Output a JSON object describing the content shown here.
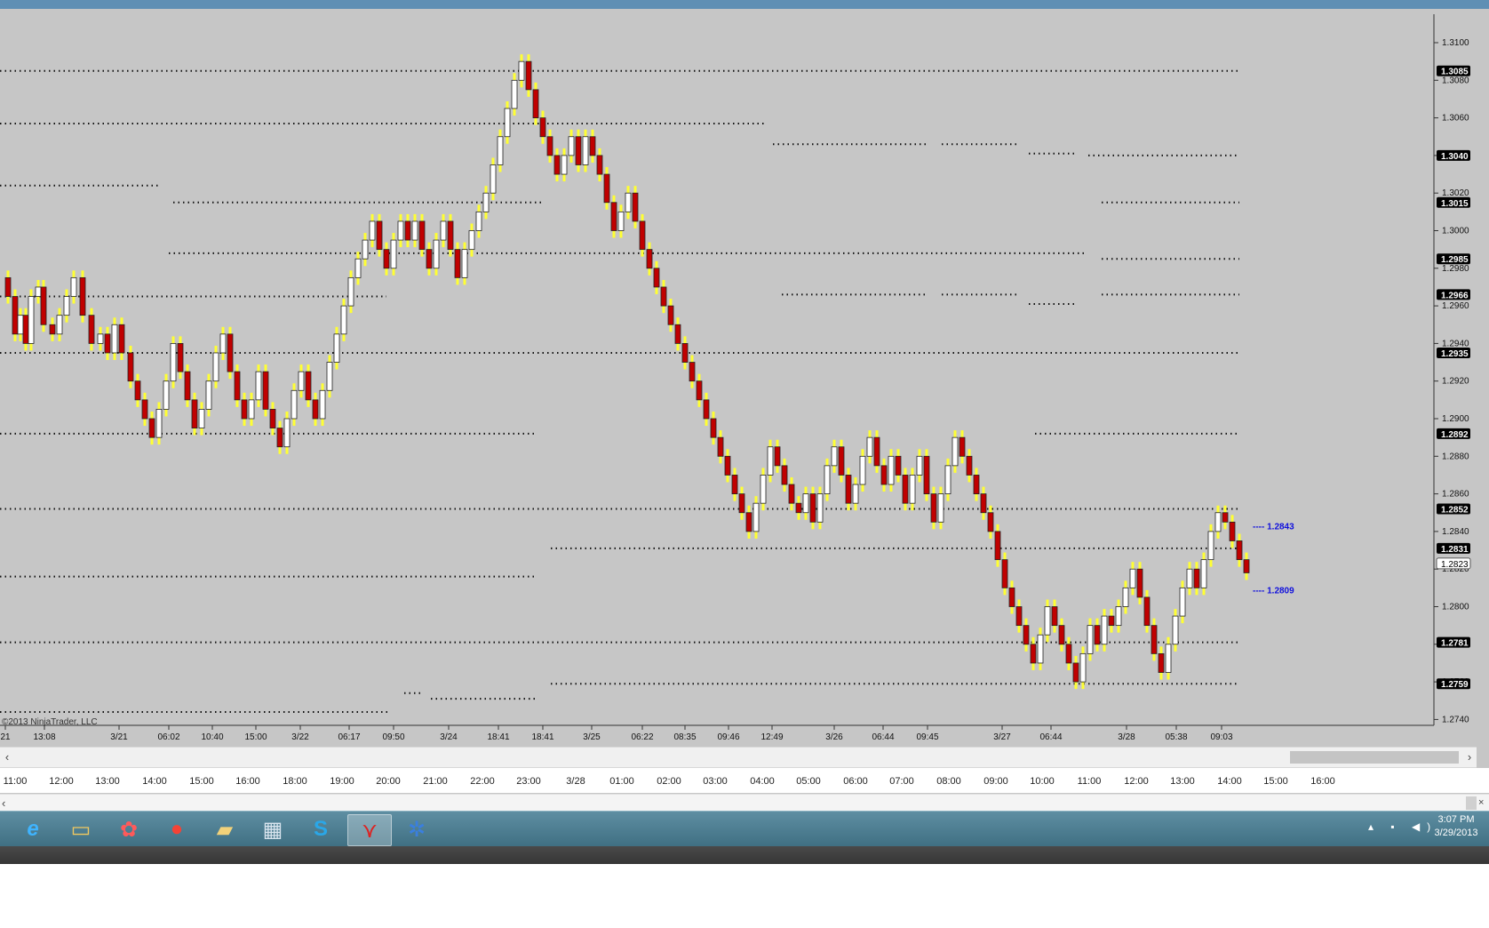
{
  "copyright": "©2013 NinjaTrader, LLC",
  "colors": {
    "background": "#c6c6c6",
    "bull_bar": "#ffffff",
    "bear_bar": "#c00000",
    "wick": "#ffff33",
    "level_line": "#111111",
    "price_marker": "#1010dd"
  },
  "price_axis": {
    "ticks": [
      "1.3100",
      "1.3080",
      "1.3060",
      "1.3040",
      "1.3020",
      "1.3000",
      "1.2980",
      "1.2960",
      "1.2940",
      "1.2920",
      "1.2900",
      "1.2880",
      "1.2860",
      "1.2840",
      "1.2820",
      "1.2800",
      "1.2780",
      "1.2760",
      "1.2740"
    ],
    "badges": [
      "1.3085",
      "1.3040",
      "1.3015",
      "1.2985",
      "1.2966",
      "1.2935",
      "1.2892",
      "1.2852",
      "1.2831",
      "1.2781",
      "1.2759"
    ],
    "current_price": "1.2823"
  },
  "markers": {
    "upper": "---- 1.2843",
    "lower": "---- 1.2809"
  },
  "date_axis_labels": [
    "21",
    "13:08",
    "3/21",
    "06:02",
    "10:40",
    "15:00",
    "3/22",
    "06:17",
    "09:50",
    "3/24",
    "18:41",
    "18:41",
    "3/25",
    "06:22",
    "08:35",
    "09:46",
    "12:49",
    "3/26",
    "06:44",
    "09:45",
    "3/27",
    "06:44",
    "3/28",
    "05:38",
    "09:03"
  ],
  "time_strip_labels": [
    "11:00",
    "12:00",
    "13:00",
    "14:00",
    "15:00",
    "16:00",
    "18:00",
    "19:00",
    "20:00",
    "21:00",
    "22:00",
    "23:00",
    "3/28",
    "01:00",
    "02:00",
    "03:00",
    "04:00",
    "05:00",
    "06:00",
    "07:00",
    "08:00",
    "09:00",
    "10:00",
    "11:00",
    "12:00",
    "13:00",
    "14:00",
    "15:00",
    "16:00"
  ],
  "taskbar": {
    "icons": [
      "internet-explorer-icon",
      "file-explorer-icon",
      "photo-app-icon",
      "chrome-icon",
      "folder-icon",
      "calculator-icon",
      "skype-icon",
      "ninjatrader-icon",
      "gear-app-icon"
    ],
    "active_icon": "ninjatrader-icon",
    "clock_time": "3:07 PM",
    "clock_date": "3/29/2013"
  }
}
